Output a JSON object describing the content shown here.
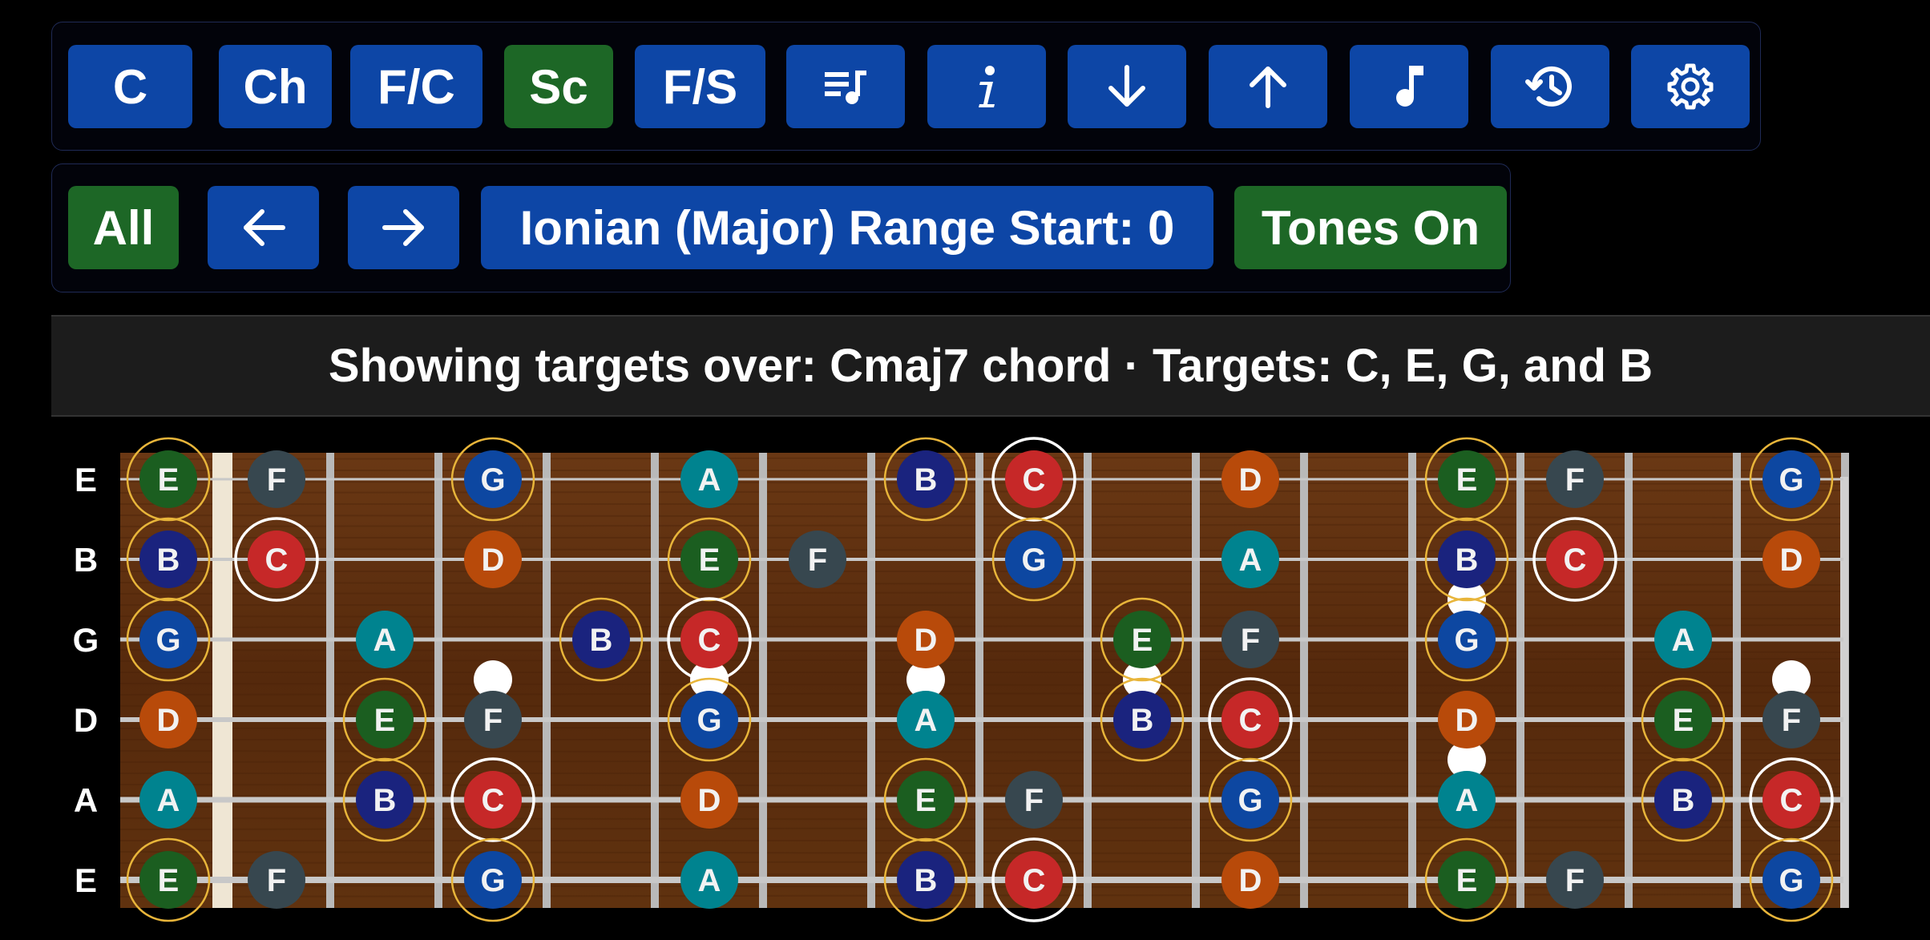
{
  "toolbar_top": {
    "buttons": [
      {
        "label": "C",
        "icon": null,
        "color": "blue"
      },
      {
        "label": "Ch",
        "icon": null,
        "color": "blue"
      },
      {
        "label": "F/C",
        "icon": null,
        "color": "blue"
      },
      {
        "label": "Sc",
        "icon": null,
        "color": "green"
      },
      {
        "label": "F/S",
        "icon": null,
        "color": "blue"
      },
      {
        "label": "",
        "icon": "playlist-music-icon",
        "color": "blue"
      },
      {
        "label": "",
        "icon": "info-icon",
        "color": "blue"
      },
      {
        "label": "",
        "icon": "arrow-down-icon",
        "color": "blue"
      },
      {
        "label": "",
        "icon": "arrow-up-icon",
        "color": "blue"
      },
      {
        "label": "",
        "icon": "music-note-icon",
        "color": "blue"
      },
      {
        "label": "",
        "icon": "history-icon",
        "color": "blue"
      },
      {
        "label": "",
        "icon": "gear-icon",
        "color": "blue"
      }
    ]
  },
  "toolbar_bottom": {
    "all_label": "All",
    "prev_icon": "arrow-left-icon",
    "next_icon": "arrow-right-icon",
    "scale_label": "Ionian (Major) Range Start: 0",
    "tones_label": "Tones On"
  },
  "status": {
    "text": "Showing targets over: Cmaj7 chord · Targets: C, E, G, and B"
  },
  "colors": {
    "blue_button": "#0d46a6",
    "green_button": "#1d6726",
    "fretboard_wood": "#5a2d10",
    "target_ring": "#e8b53a",
    "root_ring": "#ffffff"
  },
  "fretboard": {
    "strings": [
      "E",
      "B",
      "G",
      "D",
      "A",
      "E"
    ],
    "frets_shown": 15,
    "inlay_frets": [
      3,
      5,
      7,
      9,
      12,
      15
    ],
    "targets": [
      "C",
      "E",
      "G",
      "B"
    ],
    "root": "C",
    "note_colors": {
      "C": "#c62828",
      "D": "#b84a0a",
      "E": "#1b5e20",
      "F": "#37474f",
      "G": "#0d47a1",
      "A": "#00838f",
      "B": "#1a237e"
    },
    "notes": [
      {
        "string": 0,
        "fret": 0,
        "note": "E"
      },
      {
        "string": 0,
        "fret": 1,
        "note": "F"
      },
      {
        "string": 0,
        "fret": 3,
        "note": "G"
      },
      {
        "string": 0,
        "fret": 5,
        "note": "A"
      },
      {
        "string": 0,
        "fret": 7,
        "note": "B"
      },
      {
        "string": 0,
        "fret": 8,
        "note": "C"
      },
      {
        "string": 0,
        "fret": 10,
        "note": "D"
      },
      {
        "string": 0,
        "fret": 12,
        "note": "E"
      },
      {
        "string": 0,
        "fret": 13,
        "note": "F"
      },
      {
        "string": 0,
        "fret": 15,
        "note": "G"
      },
      {
        "string": 1,
        "fret": 0,
        "note": "B"
      },
      {
        "string": 1,
        "fret": 1,
        "note": "C"
      },
      {
        "string": 1,
        "fret": 3,
        "note": "D"
      },
      {
        "string": 1,
        "fret": 5,
        "note": "E"
      },
      {
        "string": 1,
        "fret": 6,
        "note": "F"
      },
      {
        "string": 1,
        "fret": 8,
        "note": "G"
      },
      {
        "string": 1,
        "fret": 10,
        "note": "A"
      },
      {
        "string": 1,
        "fret": 12,
        "note": "B"
      },
      {
        "string": 1,
        "fret": 13,
        "note": "C"
      },
      {
        "string": 1,
        "fret": 15,
        "note": "D"
      },
      {
        "string": 2,
        "fret": 0,
        "note": "G"
      },
      {
        "string": 2,
        "fret": 2,
        "note": "A"
      },
      {
        "string": 2,
        "fret": 4,
        "note": "B"
      },
      {
        "string": 2,
        "fret": 5,
        "note": "C"
      },
      {
        "string": 2,
        "fret": 7,
        "note": "D"
      },
      {
        "string": 2,
        "fret": 9,
        "note": "E"
      },
      {
        "string": 2,
        "fret": 10,
        "note": "F"
      },
      {
        "string": 2,
        "fret": 12,
        "note": "G"
      },
      {
        "string": 2,
        "fret": 14,
        "note": "A"
      },
      {
        "string": 3,
        "fret": 0,
        "note": "D"
      },
      {
        "string": 3,
        "fret": 2,
        "note": "E"
      },
      {
        "string": 3,
        "fret": 3,
        "note": "F"
      },
      {
        "string": 3,
        "fret": 5,
        "note": "G"
      },
      {
        "string": 3,
        "fret": 7,
        "note": "A"
      },
      {
        "string": 3,
        "fret": 9,
        "note": "B"
      },
      {
        "string": 3,
        "fret": 10,
        "note": "C"
      },
      {
        "string": 3,
        "fret": 12,
        "note": "D"
      },
      {
        "string": 3,
        "fret": 14,
        "note": "E"
      },
      {
        "string": 3,
        "fret": 15,
        "note": "F"
      },
      {
        "string": 4,
        "fret": 0,
        "note": "A"
      },
      {
        "string": 4,
        "fret": 2,
        "note": "B"
      },
      {
        "string": 4,
        "fret": 3,
        "note": "C"
      },
      {
        "string": 4,
        "fret": 5,
        "note": "D"
      },
      {
        "string": 4,
        "fret": 7,
        "note": "E"
      },
      {
        "string": 4,
        "fret": 8,
        "note": "F"
      },
      {
        "string": 4,
        "fret": 10,
        "note": "G"
      },
      {
        "string": 4,
        "fret": 12,
        "note": "A"
      },
      {
        "string": 4,
        "fret": 14,
        "note": "B"
      },
      {
        "string": 4,
        "fret": 15,
        "note": "C"
      },
      {
        "string": 5,
        "fret": 0,
        "note": "E"
      },
      {
        "string": 5,
        "fret": 1,
        "note": "F"
      },
      {
        "string": 5,
        "fret": 3,
        "note": "G"
      },
      {
        "string": 5,
        "fret": 5,
        "note": "A"
      },
      {
        "string": 5,
        "fret": 7,
        "note": "B"
      },
      {
        "string": 5,
        "fret": 8,
        "note": "C"
      },
      {
        "string": 5,
        "fret": 10,
        "note": "D"
      },
      {
        "string": 5,
        "fret": 12,
        "note": "E"
      },
      {
        "string": 5,
        "fret": 13,
        "note": "F"
      },
      {
        "string": 5,
        "fret": 15,
        "note": "G"
      }
    ]
  }
}
